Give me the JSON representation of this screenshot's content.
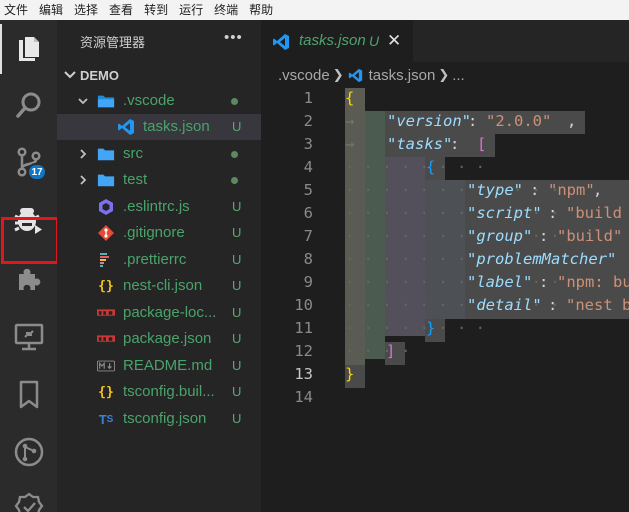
{
  "menubar": {
    "items": [
      "文件",
      "编辑",
      "选择",
      "查看",
      "转到",
      "运行",
      "终端",
      "帮助"
    ]
  },
  "activitybar": {
    "items": [
      {
        "icon": "explorer-icon",
        "active": true
      },
      {
        "icon": "search-icon"
      },
      {
        "icon": "source-control-icon",
        "badge": "17"
      },
      {
        "icon": "run-debug-icon",
        "highlighted": true
      },
      {
        "icon": "extensions-icon"
      },
      {
        "icon": "remote-explorer-icon"
      },
      {
        "icon": "bookmarks-icon"
      },
      {
        "icon": "git-graph-icon"
      },
      {
        "icon": "check-icon"
      }
    ],
    "badge": "17"
  },
  "sidebar": {
    "title": "资源管理器",
    "more": "•••",
    "root": "DEMO",
    "items": [
      {
        "name": ".vscode",
        "kind": "folder",
        "expanded": true,
        "status": "dot"
      },
      {
        "name": "tasks.json",
        "kind": "vscode-json",
        "status": "U",
        "selected": true
      },
      {
        "name": "src",
        "kind": "folder",
        "expanded": false,
        "status": "dot"
      },
      {
        "name": "test",
        "kind": "folder",
        "expanded": false,
        "status": "dot"
      },
      {
        "name": ".eslintrc.js",
        "kind": "eslint",
        "status": "U"
      },
      {
        "name": ".gitignore",
        "kind": "git",
        "status": "U"
      },
      {
        "name": ".prettierrc",
        "kind": "prettier",
        "status": "U"
      },
      {
        "name": "nest-cli.json",
        "kind": "json",
        "status": "U"
      },
      {
        "name": "package-loc...",
        "kind": "npm",
        "status": "U"
      },
      {
        "name": "package.json",
        "kind": "npm",
        "status": "U"
      },
      {
        "name": "README.md",
        "kind": "markdown",
        "status": "U"
      },
      {
        "name": "tsconfig.buil...",
        "kind": "json",
        "status": "U"
      },
      {
        "name": "tsconfig.json",
        "kind": "tsconfig",
        "status": "U"
      }
    ]
  },
  "editor": {
    "tab": {
      "label": "tasks.json",
      "status": "U",
      "close": "✕"
    },
    "breadcrumb": [
      ".vscode",
      "tasks.json",
      "..."
    ],
    "line_numbers": [
      "1",
      "2",
      "3",
      "4",
      "5",
      "6",
      "7",
      "8",
      "9",
      "10",
      "11",
      "12",
      "13",
      "14"
    ],
    "code": {
      "l1_brace": "{",
      "l2_key": "\"version\"",
      "l2_colon": ": ",
      "l2_val": "\"2.0.0\"",
      "l2_comma": ",",
      "l3_key": "\"tasks\"",
      "l3_colon": ": ",
      "l3_bracket": "[",
      "l4_brace": "{",
      "l5_key": "\"type\"",
      "l5_colon": ": ",
      "l5_val": "\"npm\"",
      "l5_comma": ",",
      "l6_key": "\"script\"",
      "l6_colon": ": ",
      "l6_val": "\"build",
      "l7_key": "\"group\"",
      "l7_colon": ": ",
      "l7_val": "\"build\"",
      "l8_key": "\"problemMatcher\"",
      "l9_key": "\"label\"",
      "l9_colon": ": ",
      "l9_val": "\"npm: bu",
      "l10_key": "\"detail\"",
      "l10_colon": ": ",
      "l10_val": "\"nest b",
      "l11_brace": "}",
      "l12_bracket": "]",
      "l13_brace": "}"
    }
  }
}
